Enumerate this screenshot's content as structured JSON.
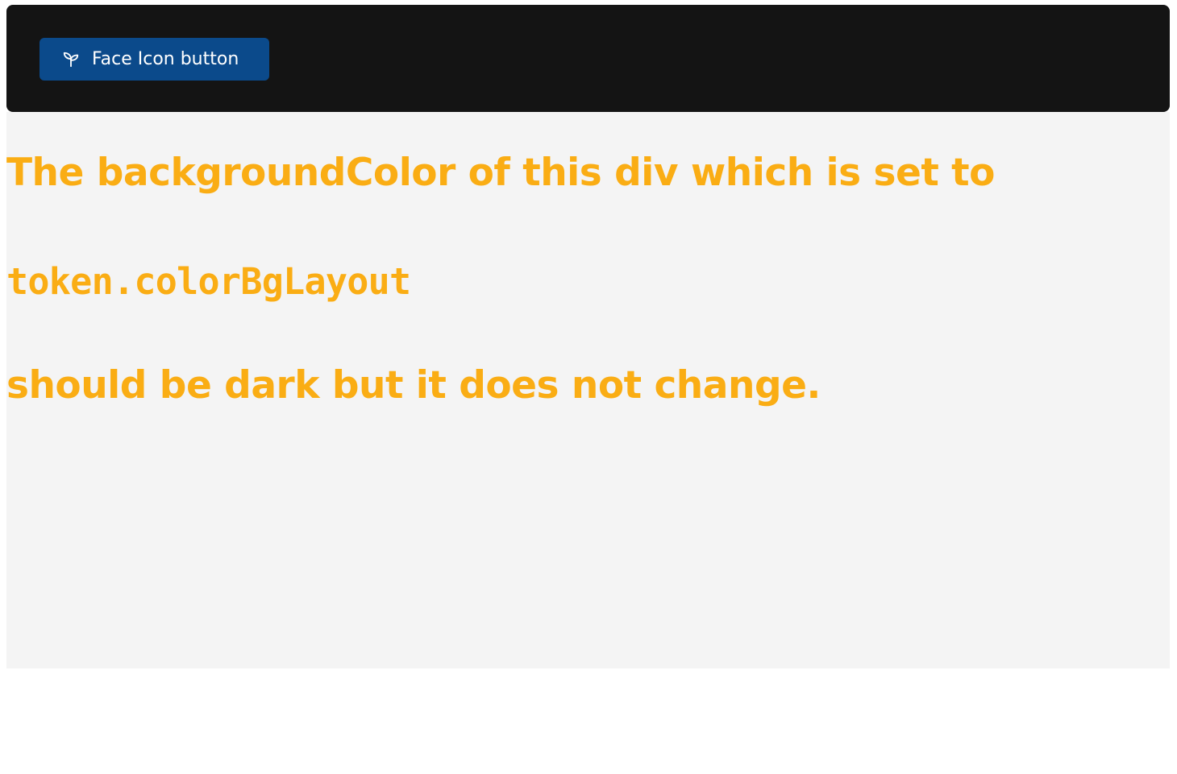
{
  "header": {
    "button_label": "Face Icon button",
    "button_icon": "seedling-icon",
    "background_color": "#141414",
    "button_color": "#0b4a8b"
  },
  "content": {
    "background_color": "#f4f4f4",
    "text_color": "#faad14",
    "line1": "The backgroundColor of this div which is set to",
    "token": "token.colorBgLayout",
    "line3": "should be dark but it does not change."
  }
}
